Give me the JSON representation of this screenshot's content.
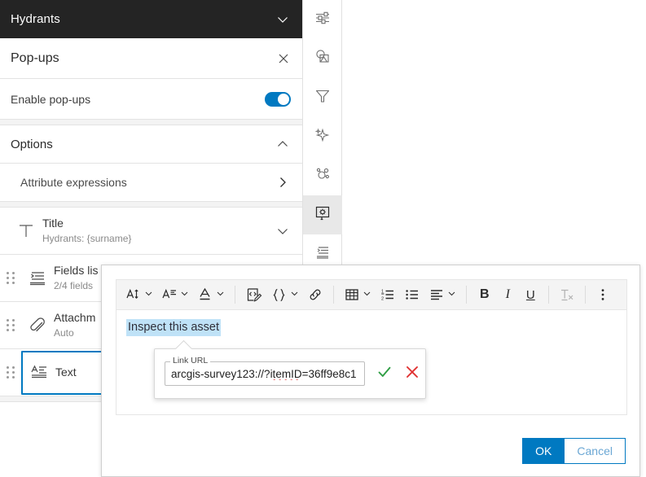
{
  "left_panel": {
    "layer_header": {
      "title": "Hydrants",
      "collapse_icon": "chevron-down-icon"
    },
    "panel": {
      "title": "Pop-ups",
      "close_icon": "close-icon"
    },
    "enable_popups": {
      "label": "Enable pop-ups",
      "state": "on"
    },
    "options": {
      "label": "Options",
      "collapse_icon": "chevron-up-icon"
    },
    "attribute_expressions": {
      "label": "Attribute expressions",
      "chevron_icon": "chevron-right-icon"
    },
    "blocks": [
      {
        "name": "title-block",
        "icon": "title-text-icon",
        "title": "Title",
        "subtitle": "Hydrants: {surname}",
        "trailing_icon": "chevron-down-icon",
        "has_handle": false,
        "selected": false
      },
      {
        "name": "fields-list-block",
        "icon": "fields-list-icon",
        "title": "Fields lis",
        "subtitle": "2/4 fields",
        "has_handle": true,
        "selected": false
      },
      {
        "name": "attachments-block",
        "icon": "paperclip-icon",
        "title": "Attachm",
        "subtitle": "Auto",
        "has_handle": true,
        "selected": false
      },
      {
        "name": "text-block",
        "icon": "text-element-icon",
        "title": "Text",
        "subtitle": "",
        "has_handle": true,
        "selected": true
      }
    ]
  },
  "right_toolbar": {
    "items": [
      {
        "name": "properties-tool",
        "icon": "sliders-icon",
        "active": false
      },
      {
        "name": "styles-tool",
        "icon": "image-symbol-icon",
        "active": false
      },
      {
        "name": "filter-tool",
        "icon": "funnel-icon",
        "active": false
      },
      {
        "name": "effects-tool",
        "icon": "sparkle-icon",
        "active": false
      },
      {
        "name": "clustering-tool",
        "icon": "molecule-icon",
        "active": false
      },
      {
        "name": "popups-tool",
        "icon": "popup-gear-icon",
        "active": true
      },
      {
        "name": "fields-tool",
        "icon": "fields-icon",
        "active": false
      }
    ]
  },
  "modal": {
    "toolbar": [
      {
        "name": "font-size-button",
        "icon": "font-size-icon",
        "label": "AI",
        "caret": true,
        "disabled": false
      },
      {
        "name": "paragraph-format-button",
        "icon": "paragraph-format-icon",
        "label": "A",
        "caret": true,
        "disabled": false
      },
      {
        "name": "font-color-button",
        "icon": "font-color-icon",
        "label": "A",
        "caret": true,
        "disabled": false
      },
      {
        "name": "divider",
        "icon": "divider",
        "disabled": false
      },
      {
        "name": "source-code-button",
        "icon": "code-edit-icon",
        "caret": false,
        "disabled": false
      },
      {
        "name": "expression-button",
        "icon": "braces-icon",
        "caret": true,
        "disabled": false
      },
      {
        "name": "insert-link-button",
        "icon": "link-icon",
        "caret": false,
        "disabled": false
      },
      {
        "name": "divider2",
        "icon": "divider",
        "disabled": false
      },
      {
        "name": "insert-table-button",
        "icon": "table-icon",
        "caret": true,
        "disabled": false
      },
      {
        "name": "ordered-list-button",
        "icon": "numbered-list-icon",
        "caret": false,
        "disabled": false
      },
      {
        "name": "unordered-list-button",
        "icon": "bulleted-list-icon",
        "caret": false,
        "disabled": false
      },
      {
        "name": "align-button",
        "icon": "align-left-icon",
        "caret": true,
        "disabled": false
      },
      {
        "name": "divider3",
        "icon": "divider",
        "disabled": false
      },
      {
        "name": "bold-button",
        "icon": "bold-icon",
        "label": "B",
        "caret": false,
        "disabled": false
      },
      {
        "name": "italic-button",
        "icon": "italic-icon",
        "label": "I",
        "caret": false,
        "disabled": false
      },
      {
        "name": "underline-button",
        "icon": "underline-icon",
        "label": "U",
        "caret": false,
        "disabled": false
      },
      {
        "name": "divider4",
        "icon": "divider",
        "disabled": false
      },
      {
        "name": "clear-formatting-button",
        "icon": "clear-format-icon",
        "caret": false,
        "disabled": true
      },
      {
        "name": "divider5",
        "icon": "divider",
        "disabled": false
      },
      {
        "name": "more-options-button",
        "icon": "kebab-menu-icon",
        "caret": false,
        "disabled": false
      }
    ],
    "editor": {
      "selected_text": "Inspect this asset",
      "selection_color": "#bfe2f7"
    },
    "link_popup": {
      "legend": "Link URL",
      "value": "arcgis-survey123://?itemID=36ff9e8c1",
      "value_plain": "arcgis-survey123://?",
      "value_misspelled": "itemID",
      "value_tail": "=36ff9e8c1",
      "confirm_icon": "check-icon",
      "confirm_color": "#2f9e44",
      "cancel_icon": "x-icon",
      "cancel_color": "#e03131"
    },
    "footer": {
      "ok_label": "OK",
      "cancel_label": "Cancel",
      "primary_color": "#0079c1"
    }
  }
}
